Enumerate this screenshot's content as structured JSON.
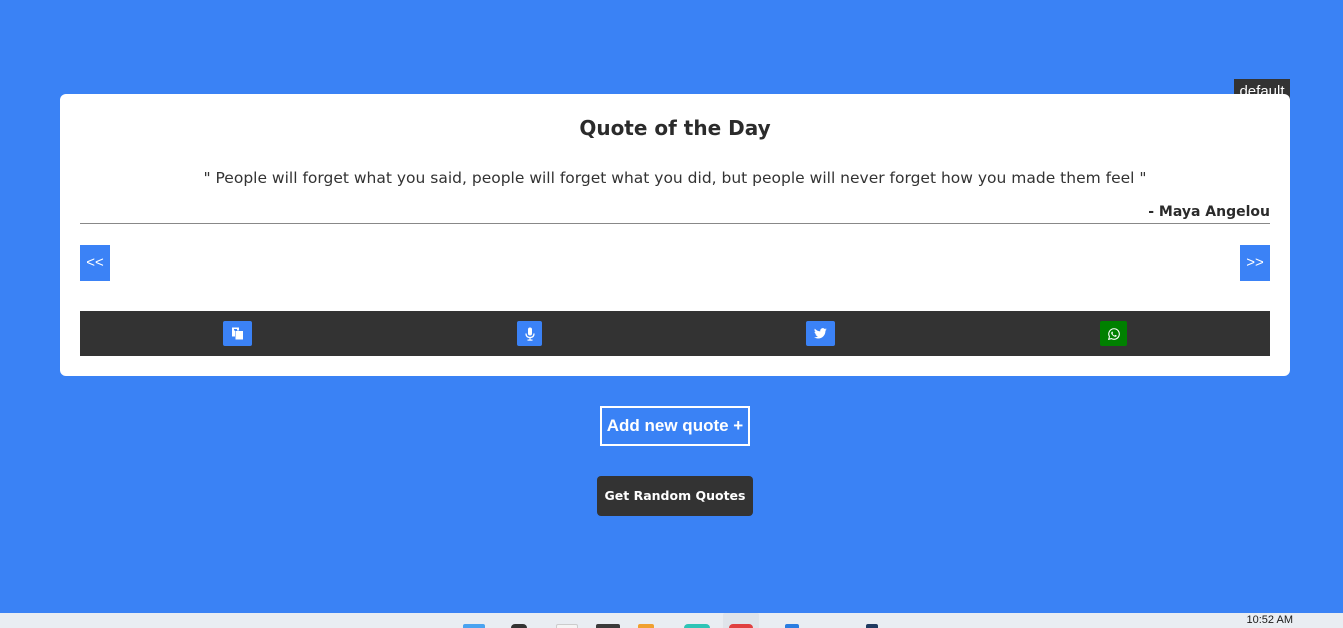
{
  "category": {
    "label": "default"
  },
  "card": {
    "title": "Quote of the Day",
    "quote": "\" People will forget what you said, people will forget what you did, but people will never forget how you made them feel \"",
    "author": "- Maya Angelou",
    "prev_label": "<<",
    "next_label": ">>"
  },
  "actions": {
    "copy_icon": "copy-icon",
    "speak_icon": "microphone-icon",
    "twitter_icon": "twitter-icon",
    "whatsapp_icon": "whatsapp-icon"
  },
  "buttons": {
    "add_quote": "Add new quote +",
    "random_quotes": "Get Random Quotes"
  },
  "taskbar": {
    "clock": "10:52 AM"
  },
  "colors": {
    "background": "#3a82f5",
    "accent": "#3b82f6",
    "dark": "#333333",
    "whatsapp": "#008000"
  }
}
